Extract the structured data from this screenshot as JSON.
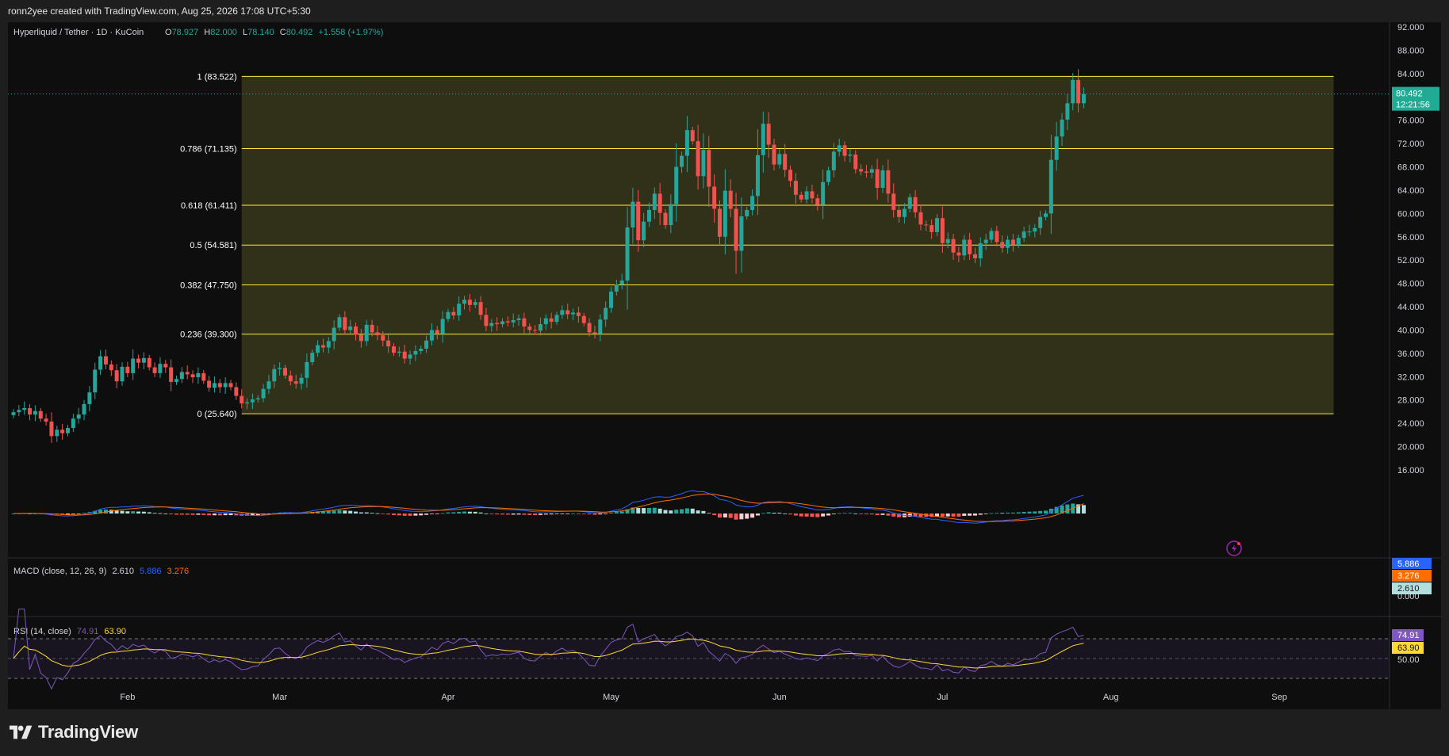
{
  "header": {
    "credit": "ronn2yee created with TradingView.com, Aug 25, 2026 17:08 UTC+5:30"
  },
  "legend": {
    "symbol": "Hyperliquid / Tether · 1D · KuCoin",
    "o_label": "O",
    "o": "78.927",
    "h_label": "H",
    "h": "82.000",
    "l_label": "L",
    "l": "78.140",
    "c_label": "C",
    "c": "80.492",
    "change": "+1.558 (+1.97%)"
  },
  "price_badge": {
    "price": "80.492",
    "countdown": "12:21:56"
  },
  "macd": {
    "title": "MACD (close, 12, 26, 9)",
    "histogram": "2.610",
    "macd": "5.886",
    "signal": "3.276",
    "zero": "0.000"
  },
  "rsi": {
    "title": "RSI (14, close)",
    "rsi": "74.91",
    "ma": "63.90",
    "mid": "50.00"
  },
  "brand": {
    "name": "TradingView"
  },
  "colors": {
    "up": "#26a69a",
    "down": "#ef5350",
    "fib": "#ffeb3b",
    "macd_line": "#2962ff",
    "signal_line": "#ff6d00",
    "rsi_line": "#7e57c2",
    "rsi_ma": "#fdd835",
    "badge": "#22ab94"
  },
  "chart_data": {
    "type": "candlestick",
    "symbol": "Hyperliquid / Tether",
    "timeframe": "1D",
    "exchange": "KuCoin",
    "y_ticks": [
      "92.000",
      "88.000",
      "84.000",
      "80.000",
      "76.000",
      "72.000",
      "68.000",
      "64.000",
      "60.000",
      "56.000",
      "52.000",
      "48.000",
      "44.000",
      "40.000",
      "36.000",
      "32.000",
      "28.000",
      "24.000",
      "20.000",
      "16.000"
    ],
    "ylim": [
      16,
      92
    ],
    "x_ticks": [
      {
        "label": "Feb",
        "day": 21
      },
      {
        "label": "Mar",
        "day": 49
      },
      {
        "label": "Apr",
        "day": 80
      },
      {
        "label": "May",
        "day": 110
      },
      {
        "label": "Jun",
        "day": 141
      },
      {
        "label": "Jul",
        "day": 171
      },
      {
        "label": "Aug",
        "day": 202
      },
      {
        "label": "Sep",
        "day": 233
      }
    ],
    "fibonacci": [
      {
        "level": "1",
        "value": 83.522,
        "label": "1 (83.522)"
      },
      {
        "level": "0.786",
        "value": 71.135,
        "label": "0.786 (71.135)"
      },
      {
        "level": "0.618",
        "value": 61.411,
        "label": "0.618 (61.411)"
      },
      {
        "level": "0.5",
        "value": 54.581,
        "label": "0.5 (54.581)"
      },
      {
        "level": "0.382",
        "value": 47.75,
        "label": "0.382 (47.750)"
      },
      {
        "level": "0.236",
        "value": 39.3,
        "label": "0.236 (39.300)"
      },
      {
        "level": "0",
        "value": 25.64,
        "label": "0 (25.640)"
      }
    ],
    "fib_range_days": [
      42,
      243
    ],
    "close_series": [
      25.9,
      26.3,
      26.6,
      25.5,
      26.1,
      24.8,
      24.3,
      21.8,
      22.9,
      22.3,
      23.2,
      24.8,
      25.5,
      27.3,
      29.3,
      33.2,
      35.5,
      34.1,
      33.1,
      31.2,
      33.7,
      32.6,
      35.1,
      34.4,
      35.2,
      33.6,
      32.6,
      34.2,
      33.6,
      31.1,
      31.6,
      32.8,
      32.4,
      31.9,
      32.6,
      31.3,
      30.1,
      30.9,
      30.2,
      30.9,
      30.2,
      28.7,
      27.4,
      27.6,
      28.1,
      28.3,
      29.9,
      31.2,
      33.3,
      33.5,
      32.2,
      31.2,
      30.8,
      31.8,
      34.5,
      36.1,
      37.4,
      37.0,
      38.1,
      40.4,
      42.2,
      40.0,
      40.6,
      39.2,
      38.1,
      40.9,
      39.6,
      39.1,
      38.2,
      37.2,
      36.1,
      36.3,
      35.1,
      35.8,
      36.4,
      36.8,
      38.2,
      40.0,
      39.4,
      41.9,
      43.1,
      42.5,
      44.5,
      45.2,
      44.3,
      44.8,
      42.6,
      40.7,
      41.2,
      41.0,
      41.5,
      41.3,
      41.7,
      42.0,
      40.6,
      40.0,
      39.9,
      41.0,
      42.0,
      41.4,
      42.6,
      43.4,
      42.7,
      43.0,
      42.4,
      41.2,
      39.6,
      39.4,
      41.8,
      43.8,
      46.6,
      47.8,
      48.5,
      57.6,
      62.0,
      55.4,
      58.6,
      60.6,
      63.4,
      60.1,
      58.0,
      61.6,
      68.0,
      69.9,
      74.3,
      72.4,
      66.4,
      70.9,
      64.6,
      60.8,
      56.0,
      63.9,
      60.8,
      53.6,
      59.5,
      60.6,
      63.0,
      70.0,
      75.4,
      71.8,
      68.4,
      70.2,
      67.5,
      65.6,
      63.2,
      62.4,
      63.8,
      62.6,
      61.5,
      65.4,
      67.4,
      70.6,
      71.7,
      69.9,
      70.1,
      67.6,
      67.2,
      67.0,
      67.6,
      64.4,
      67.4,
      63.4,
      60.6,
      59.4,
      60.8,
      62.8,
      60.2,
      58.1,
      58.0,
      56.8,
      59.2,
      54.9,
      55.6,
      53.3,
      52.8,
      55.5,
      53.0,
      52.3,
      54.9,
      55.5,
      57.0,
      55.1,
      54.1,
      55.5,
      54.6,
      55.8,
      56.9,
      56.9,
      57.5,
      59.4,
      60.0,
      69.2,
      73.2,
      76.1,
      78.9,
      82.9,
      78.9,
      80.5
    ],
    "highs_lows_note": "",
    "macd": {
      "macd": 5.886,
      "signal": 3.276,
      "histogram": 2.61
    },
    "rsi": {
      "value": 74.91,
      "ma": 63.9,
      "levels": [
        70,
        50,
        30
      ]
    },
    "last": {
      "open": 78.927,
      "high": 82.0,
      "low": 78.14,
      "close": 80.492,
      "change": 1.558,
      "change_pct": 1.97
    }
  }
}
